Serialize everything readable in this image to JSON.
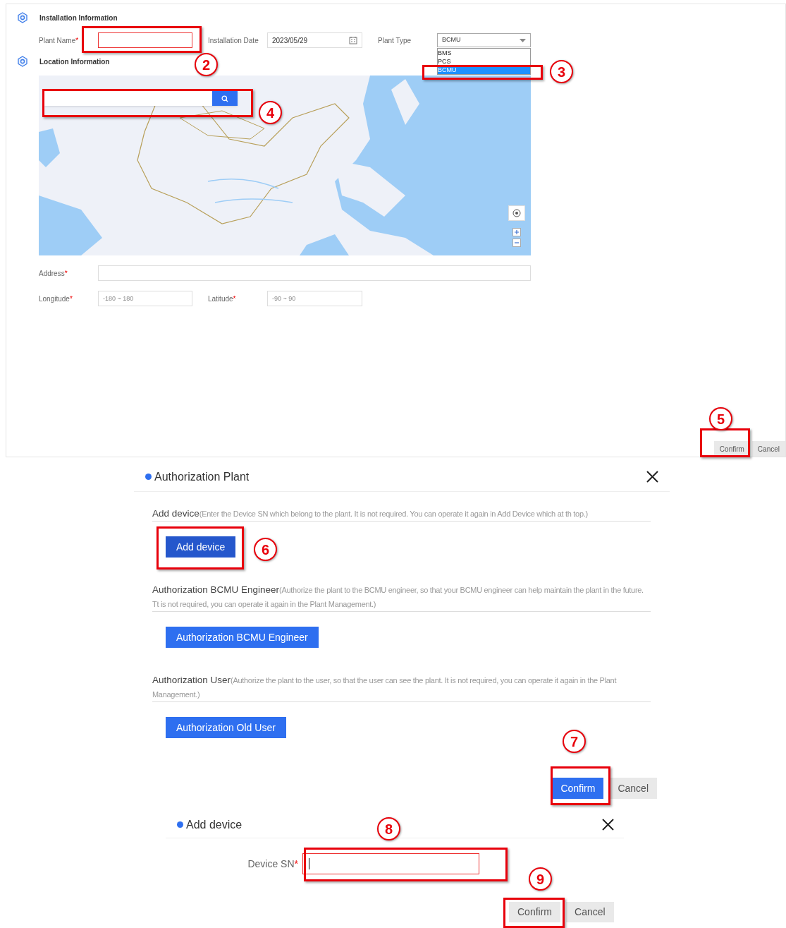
{
  "plant_form": {
    "installation_heading": "Installation Information",
    "plant_name": {
      "label": "Plant Name",
      "mark": "*"
    },
    "installation_date": {
      "label": "Installation Date",
      "value": "2023/05/29"
    },
    "plant_type": {
      "label": "Plant Type",
      "value": "BCMU",
      "expanded": true,
      "options": [
        {
          "label": "BMS",
          "selected": false
        },
        {
          "label": "PCS",
          "selected": false
        },
        {
          "label": "BCMU",
          "selected": true
        }
      ]
    },
    "location_heading": "Location Information",
    "address": {
      "label": "Address",
      "mark": "*"
    },
    "longitude": {
      "label": "Longitude",
      "mark": "*",
      "placeholder": "-180 ~ 180"
    },
    "latitude": {
      "label": "Latitude",
      "mark": "*",
      "placeholder": "-90 ~ 90"
    },
    "buttons": [
      {
        "label": "Confirm",
        "kind": "secondary"
      },
      {
        "label": "Cancel",
        "kind": "secondary"
      }
    ]
  },
  "authorization_dialog": {
    "title": "Authorization Plant",
    "sections": [
      {
        "title": "Add device",
        "note": "(Enter the Device SN which belong to the plant. It is not required. You can operate it again in Add Device which at th top.)",
        "button": "Add device"
      },
      {
        "title": "Authorization BCMU Engineer",
        "note": "(Authorize the plant to the BCMU engineer, so that your BCMU engineer can help maintain the plant in the future. Tt is not required, you can operate it again in the Plant Management.)",
        "button": "Authorization BCMU Engineer"
      },
      {
        "title": "Authorization User",
        "note": "(Authorize the plant to the user, so that the user can see the plant. It is not required, you can operate it again in the Plant Management.)",
        "button": "Authorization Old User"
      }
    ],
    "buttons": [
      {
        "label": "Confirm",
        "kind": "primary"
      },
      {
        "label": "Cancel",
        "kind": "secondary"
      }
    ]
  },
  "add_device_dialog": {
    "title": "Add device",
    "field": {
      "label": "Device SN",
      "mark": "*",
      "focused": true
    },
    "buttons": [
      {
        "label": "Confirm",
        "kind": "secondary"
      },
      {
        "label": "Cancel",
        "kind": "secondary"
      }
    ]
  },
  "annotations": [
    {
      "label": "2"
    },
    {
      "label": "3"
    },
    {
      "label": "4"
    },
    {
      "label": "5"
    },
    {
      "label": "6"
    },
    {
      "label": "7"
    },
    {
      "label": "8"
    },
    {
      "label": "9"
    }
  ]
}
